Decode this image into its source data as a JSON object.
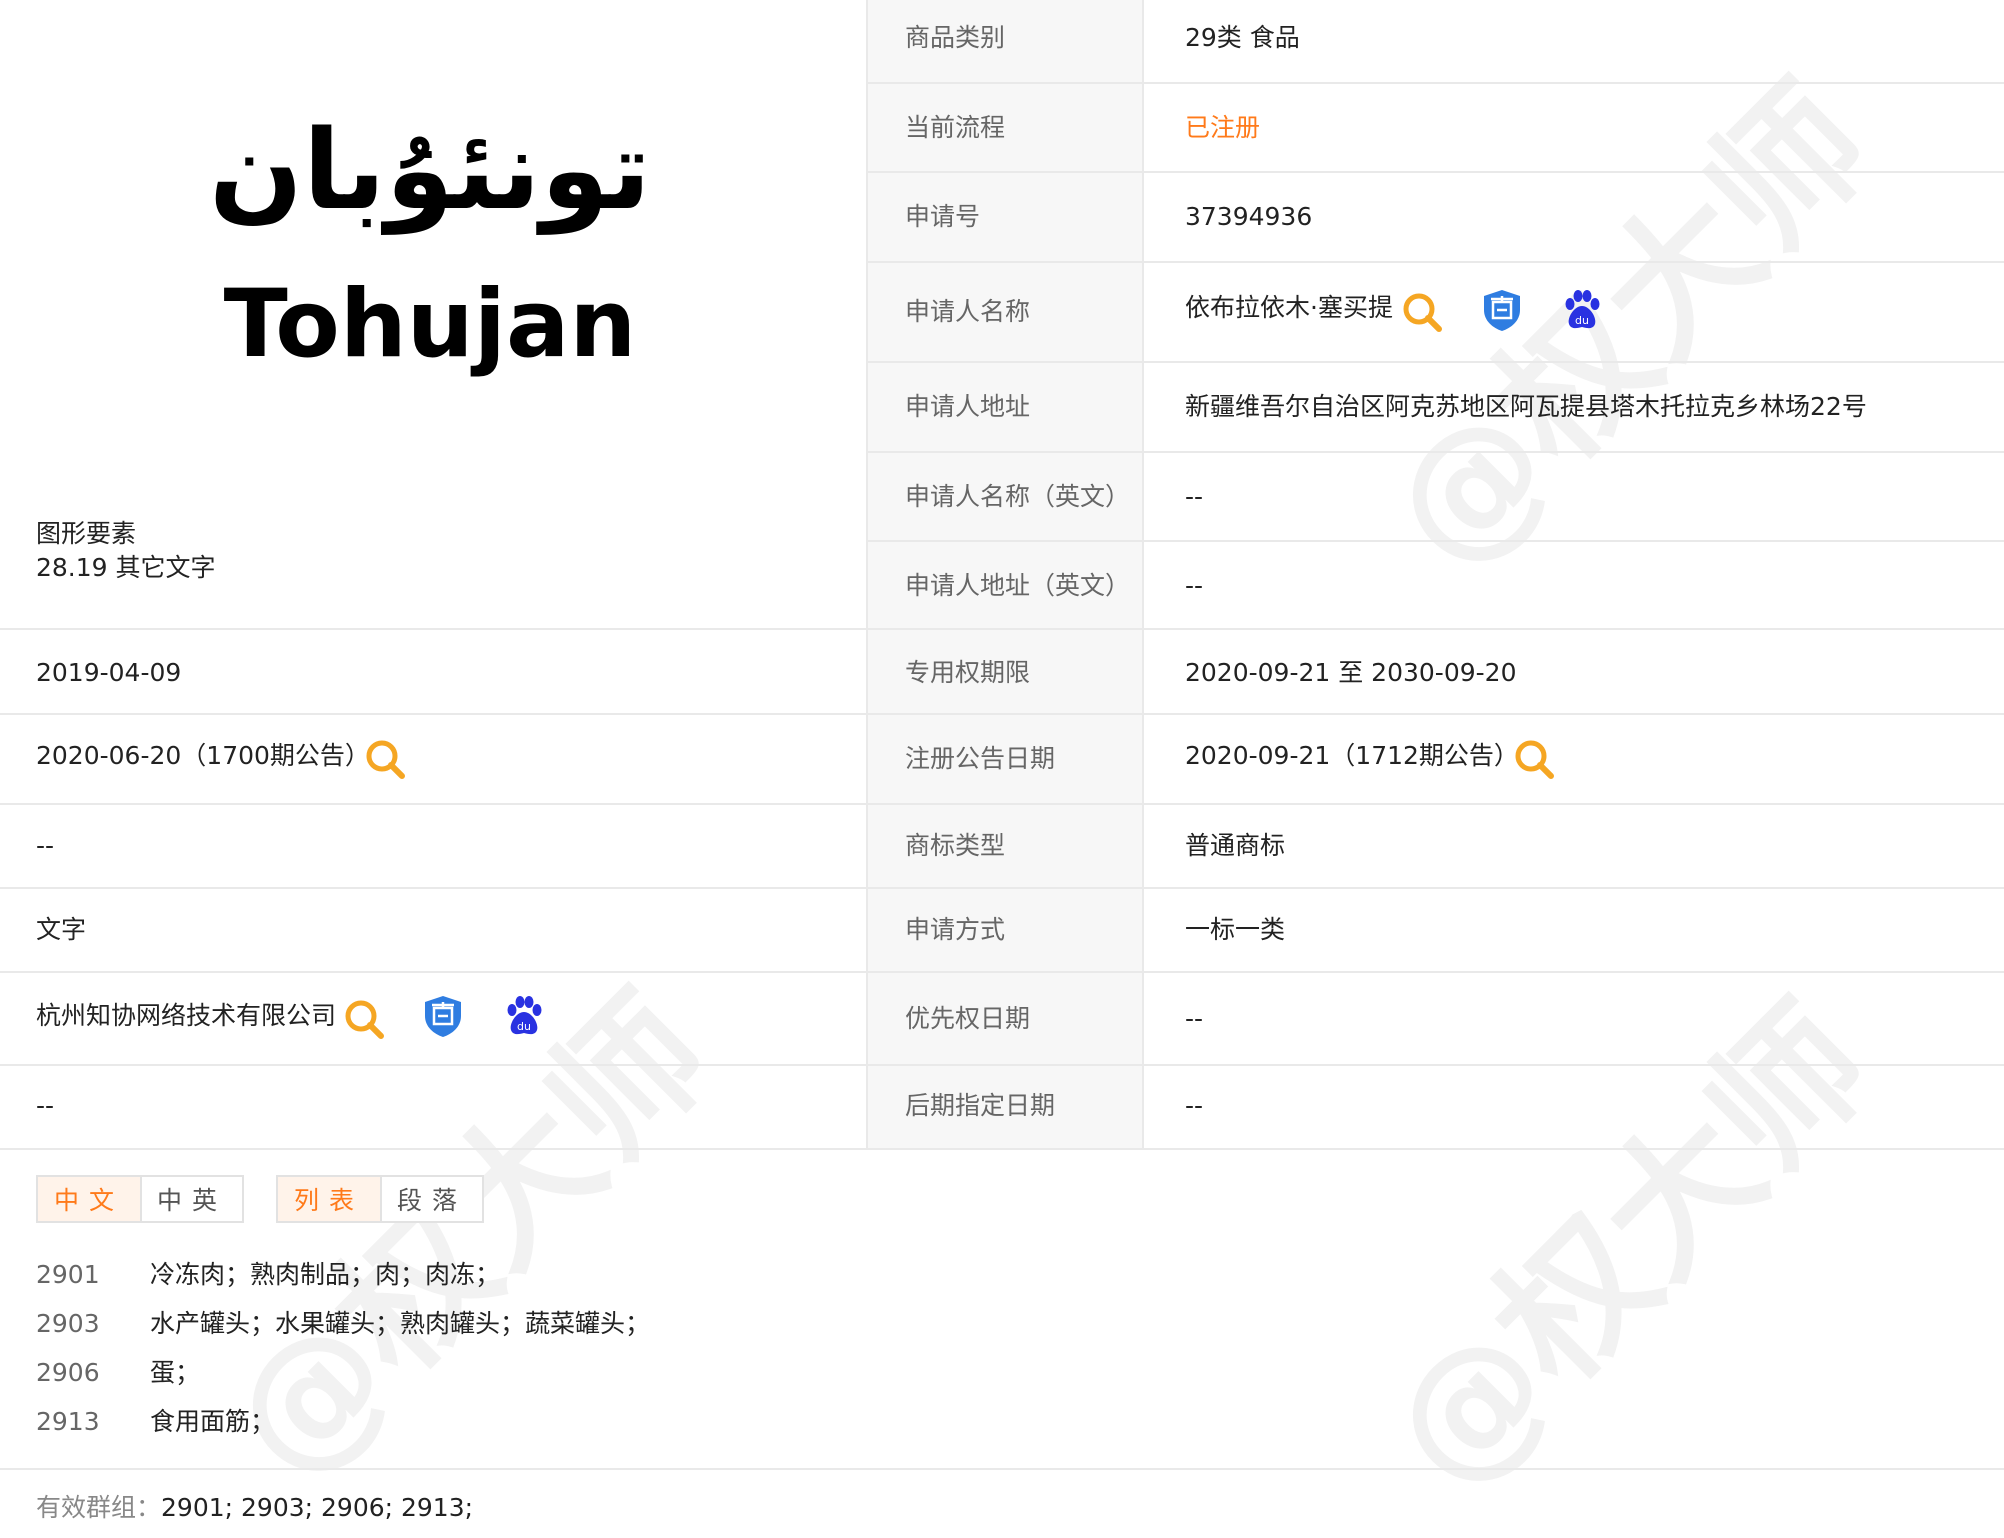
{
  "logo": {
    "arabic_text": "تونئۇبان",
    "latin_text": "Tohujan"
  },
  "figure_elements": {
    "label": "图形要素",
    "value": "28.19 其它文字"
  },
  "left_rows": {
    "application_date": "2019-04-09",
    "preliminary_announcement": "2020-06-20（1700期公告）",
    "international_date": "--",
    "mark_form": "文字",
    "agency": "杭州知协网络技术有限公司",
    "remark": "--"
  },
  "right_rows": {
    "category_label": "商品类别",
    "category_value": "29类 食品",
    "process_label": "当前流程",
    "process_value": "已注册",
    "regno_label": "申请号",
    "regno_value": "37394936",
    "applicant_label": "申请人名称",
    "applicant_value": "依布拉依木·塞买提",
    "address_label": "申请人地址",
    "address_value": "新疆维吾尔自治区阿克苏地区阿瓦提县塔木托拉克乡林场22号",
    "applicant_en_label": "申请人名称（英文）",
    "applicant_en_value": "--",
    "address_en_label": "申请人地址（英文）",
    "address_en_value": "--",
    "term_label": "专用权期限",
    "term_value": "2020-09-21 至 2030-09-20",
    "reg_announce_label": "注册公告日期",
    "reg_announce_value": "2020-09-21（1712期公告）",
    "type_label": "商标类型",
    "type_value": "普通商标",
    "method_label": "申请方式",
    "method_value": "一标一类",
    "priority_label": "优先权日期",
    "priority_value": "--",
    "later_label": "后期指定日期",
    "later_value": "--"
  },
  "toggles": {
    "lang_cn": "中文",
    "lang_cn_en": "中英",
    "view_list": "列表",
    "view_paragraph": "段落"
  },
  "goods": [
    {
      "code": "2901",
      "text": "冷冻肉；熟肉制品；肉；肉冻；"
    },
    {
      "code": "2903",
      "text": "水产罐头；水果罐头；熟肉罐头；蔬菜罐头；"
    },
    {
      "code": "2906",
      "text": "蛋；"
    },
    {
      "code": "2913",
      "text": "食用面筋；"
    }
  ],
  "valid_groups": {
    "label": "有效群组：",
    "value": "2901;   2903;   2906;   2913;"
  },
  "watermark": "@权大师",
  "icons": {
    "search": "search-icon",
    "shield": "shangbiao-shield-icon",
    "baidu": "baidu-paw-icon",
    "colors": {
      "search": "#f5a623",
      "shield": "#2f7de1",
      "baidu": "#2932e1"
    }
  }
}
